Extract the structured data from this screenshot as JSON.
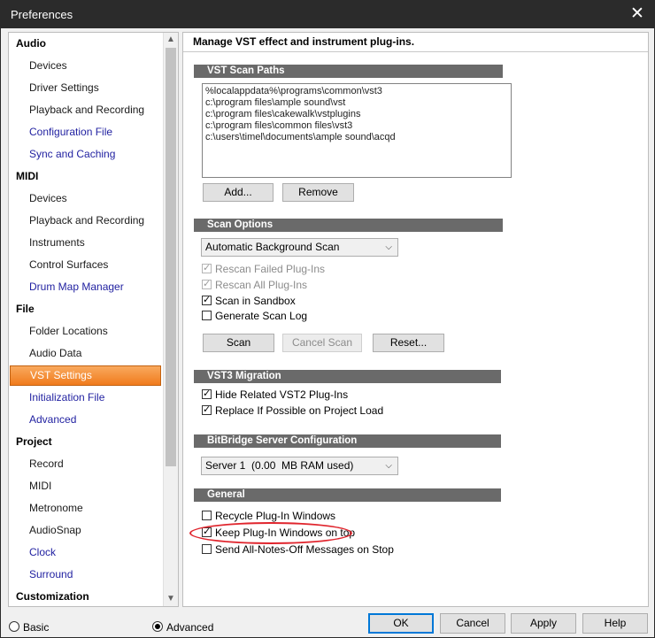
{
  "window": {
    "title": "Preferences",
    "close_glyph": "✕"
  },
  "sidebar": {
    "rows": [
      {
        "type": "cat",
        "label": "Audio"
      },
      {
        "type": "item",
        "label": "Devices"
      },
      {
        "type": "item",
        "label": "Driver Settings"
      },
      {
        "type": "item",
        "label": "Playback and Recording"
      },
      {
        "type": "link",
        "label": "Configuration File"
      },
      {
        "type": "link",
        "label": "Sync and Caching"
      },
      {
        "type": "cat",
        "label": "MIDI"
      },
      {
        "type": "item",
        "label": "Devices"
      },
      {
        "type": "item",
        "label": "Playback and Recording"
      },
      {
        "type": "item",
        "label": "Instruments"
      },
      {
        "type": "item",
        "label": "Control Surfaces"
      },
      {
        "type": "link",
        "label": "Drum Map Manager"
      },
      {
        "type": "cat",
        "label": "File"
      },
      {
        "type": "item",
        "label": "Folder Locations"
      },
      {
        "type": "item",
        "label": "Audio Data"
      },
      {
        "type": "selected",
        "label": "VST Settings"
      },
      {
        "type": "link",
        "label": "Initialization File"
      },
      {
        "type": "link",
        "label": "Advanced"
      },
      {
        "type": "cat",
        "label": "Project"
      },
      {
        "type": "item",
        "label": "Record"
      },
      {
        "type": "item",
        "label": "MIDI"
      },
      {
        "type": "item",
        "label": "Metronome"
      },
      {
        "type": "item",
        "label": "AudioSnap"
      },
      {
        "type": "link",
        "label": "Clock"
      },
      {
        "type": "link",
        "label": "Surround"
      },
      {
        "type": "cat",
        "label": "Customization"
      }
    ]
  },
  "main": {
    "header": "Manage VST effect and instrument plug-ins.",
    "scan_paths": {
      "title": "VST Scan Paths",
      "paths": [
        "%localappdata%\\programs\\common\\vst3",
        "c:\\program files\\ample sound\\vst",
        "c:\\program files\\cakewalk\\vstplugins",
        "c:\\program files\\common files\\vst3",
        "c:\\users\\timel\\documents\\ample sound\\acqd"
      ],
      "add_label": "Add...",
      "remove_label": "Remove"
    },
    "scan_options": {
      "title": "Scan Options",
      "mode": "Automatic Background Scan",
      "rescan_failed": "Rescan Failed Plug-Ins",
      "rescan_all": "Rescan All Plug-Ins",
      "scan_sandbox": "Scan in Sandbox",
      "gen_log": "Generate Scan Log",
      "scan_label": "Scan",
      "cancel_scan_label": "Cancel Scan",
      "reset_label": "Reset..."
    },
    "vst3_migration": {
      "title": "VST3 Migration",
      "hide_related": "Hide Related VST2 Plug-Ins",
      "replace_possible": "Replace If Possible on Project Load"
    },
    "bitbridge": {
      "title": "BitBridge Server Configuration",
      "server": "Server 1  (0.00  MB RAM used)"
    },
    "general": {
      "title": "General",
      "recycle": "Recycle Plug-In Windows",
      "keep_on_top": "Keep Plug-In Windows on top",
      "send_notes_off": "Send All-Notes-Off Messages on Stop"
    },
    "checkbox_states": {
      "rescan_failed": true,
      "rescan_all": true,
      "scan_sandbox": true,
      "gen_log": false,
      "hide_related": true,
      "replace_possible": true,
      "recycle": false,
      "keep_on_top": true,
      "send_notes_off": false
    }
  },
  "footer": {
    "basic_label": "Basic",
    "advanced_label": "Advanced",
    "selected_mode": "Advanced",
    "ok_label": "OK",
    "cancel_label": "Cancel",
    "apply_label": "Apply",
    "help_label": "Help"
  },
  "colors": {
    "selected_item": "#f07b1c",
    "annotation": "#e0252d",
    "section_header": "#6a6a6a",
    "link": "#1f1fa0"
  }
}
